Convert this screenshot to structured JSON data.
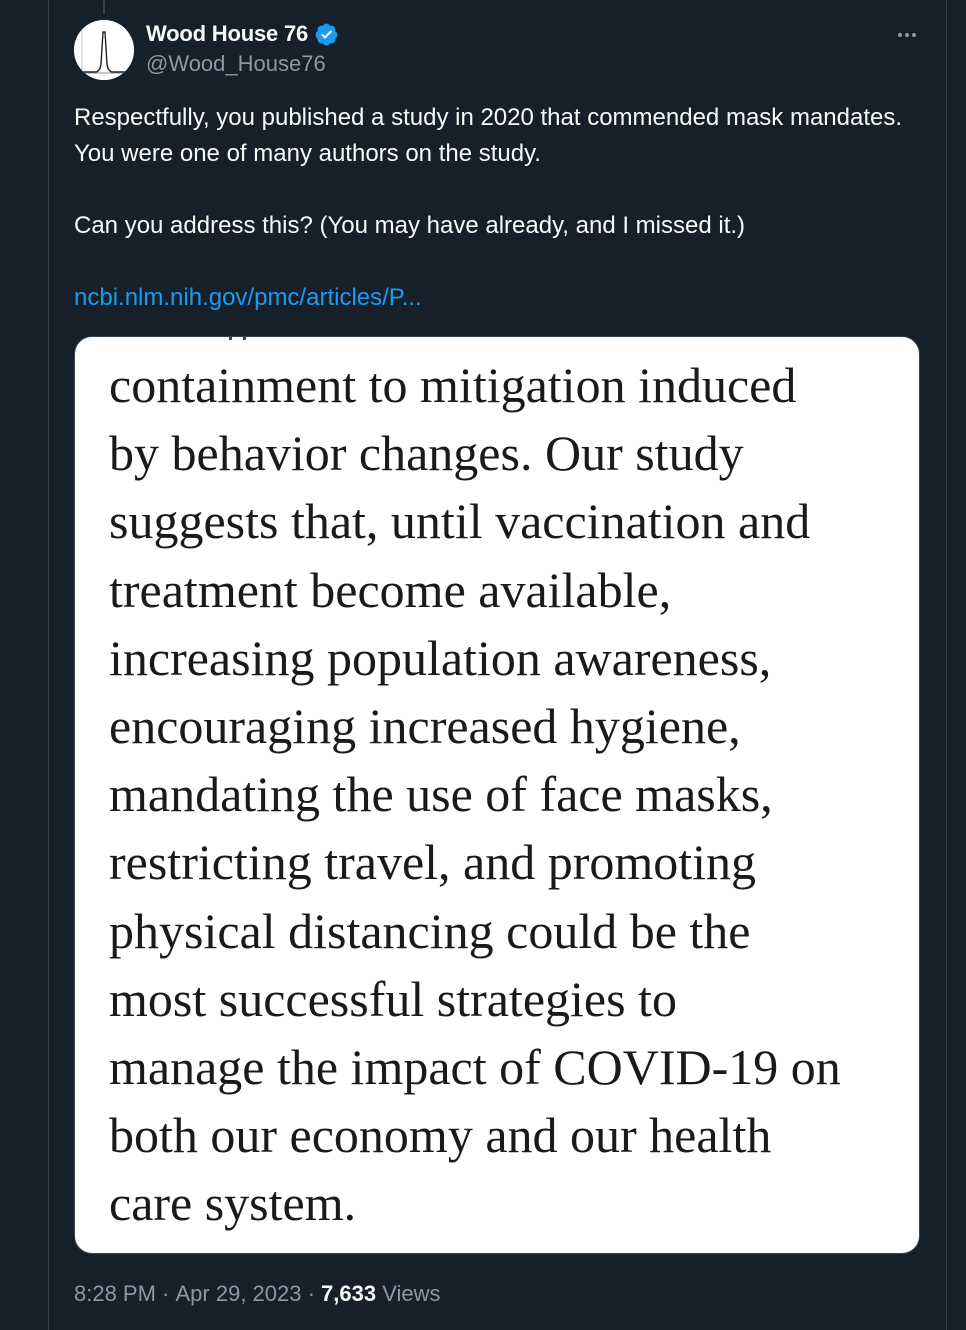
{
  "tweet": {
    "author": {
      "display_name": "Wood House 76",
      "handle": "@Wood_House76",
      "verified": true
    },
    "text": {
      "paragraph1": "Respectfully, you published a study in 2020 that commended mask mandates. You were one of many authors on the study.",
      "paragraph2": "Can you address this? (You may have already, and I missed it.)",
      "link": "ncbi.nlm.nih.gov/pmc/articles/P..."
    },
    "media": {
      "lines": [
        "containment to mitigation induced",
        "by behavior changes. Our study",
        "suggests that, until vaccination and",
        "treatment become available,",
        "increasing population awareness,",
        "encouraging increased hygiene,",
        "mandating the use of face masks,",
        "restricting travel, and promoting",
        "physical distancing could be the",
        "most successful strategies to",
        "manage the impact of COVID-19 on",
        "both our economy and our health",
        "care system."
      ]
    },
    "meta": {
      "time": "8:28 PM",
      "separator": " · ",
      "date": "Apr 29, 2023",
      "views_count": "7,633",
      "views_label": " Views"
    }
  },
  "colors": {
    "background": "#15202b",
    "border": "#38444d",
    "primary_text": "#f7f9f9",
    "secondary_text": "#8b98a5",
    "link": "#1d9bf0",
    "verified_badge": "#1d9bf0"
  },
  "icons": {
    "verified": "verified-badge-icon",
    "more": "more-options-icon"
  }
}
